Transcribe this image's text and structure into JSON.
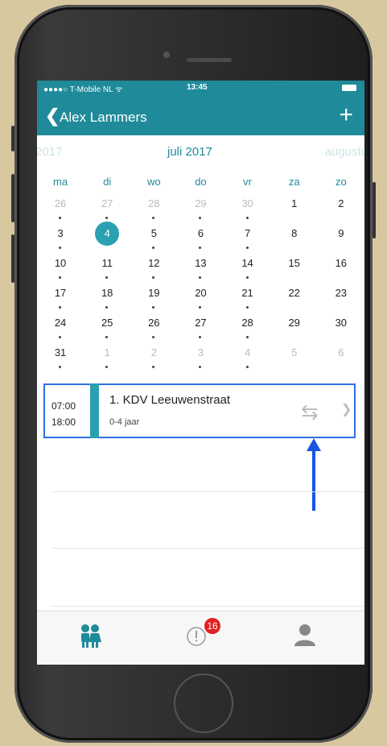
{
  "status": {
    "carrier": "●●●●○ T-Mobile NL ᯤ",
    "time": "13:45"
  },
  "nav": {
    "title": "Alex Lammers",
    "back_icon": "chevron-left-icon",
    "add_icon": "plus-icon"
  },
  "calendar": {
    "prev_month": "2017",
    "current_month": "juli 2017",
    "next_month": "augustu",
    "weekdays": [
      "ma",
      "di",
      "wo",
      "do",
      "vr",
      "za",
      "zo"
    ],
    "weeks": [
      [
        "26",
        "27",
        "28",
        "29",
        "30",
        "1",
        "2"
      ],
      [
        "3",
        "4",
        "5",
        "6",
        "7",
        "8",
        "9"
      ],
      [
        "10",
        "11",
        "12",
        "13",
        "14",
        "15",
        "16"
      ],
      [
        "17",
        "18",
        "19",
        "20",
        "21",
        "22",
        "23"
      ],
      [
        "24",
        "25",
        "26",
        "27",
        "28",
        "29",
        "30"
      ],
      [
        "31",
        "1",
        "2",
        "3",
        "4",
        "5",
        "6"
      ]
    ]
  },
  "event": {
    "start": "07:00",
    "end": "18:00",
    "name": "1. KDV Leeuwenstraat",
    "age": "0-4 jaar"
  },
  "tabs": {
    "notifications_badge": "16"
  },
  "colors": {
    "accent": "#1f8a99",
    "highlight_border": "#2f6fe0",
    "badge": "#e02020"
  }
}
